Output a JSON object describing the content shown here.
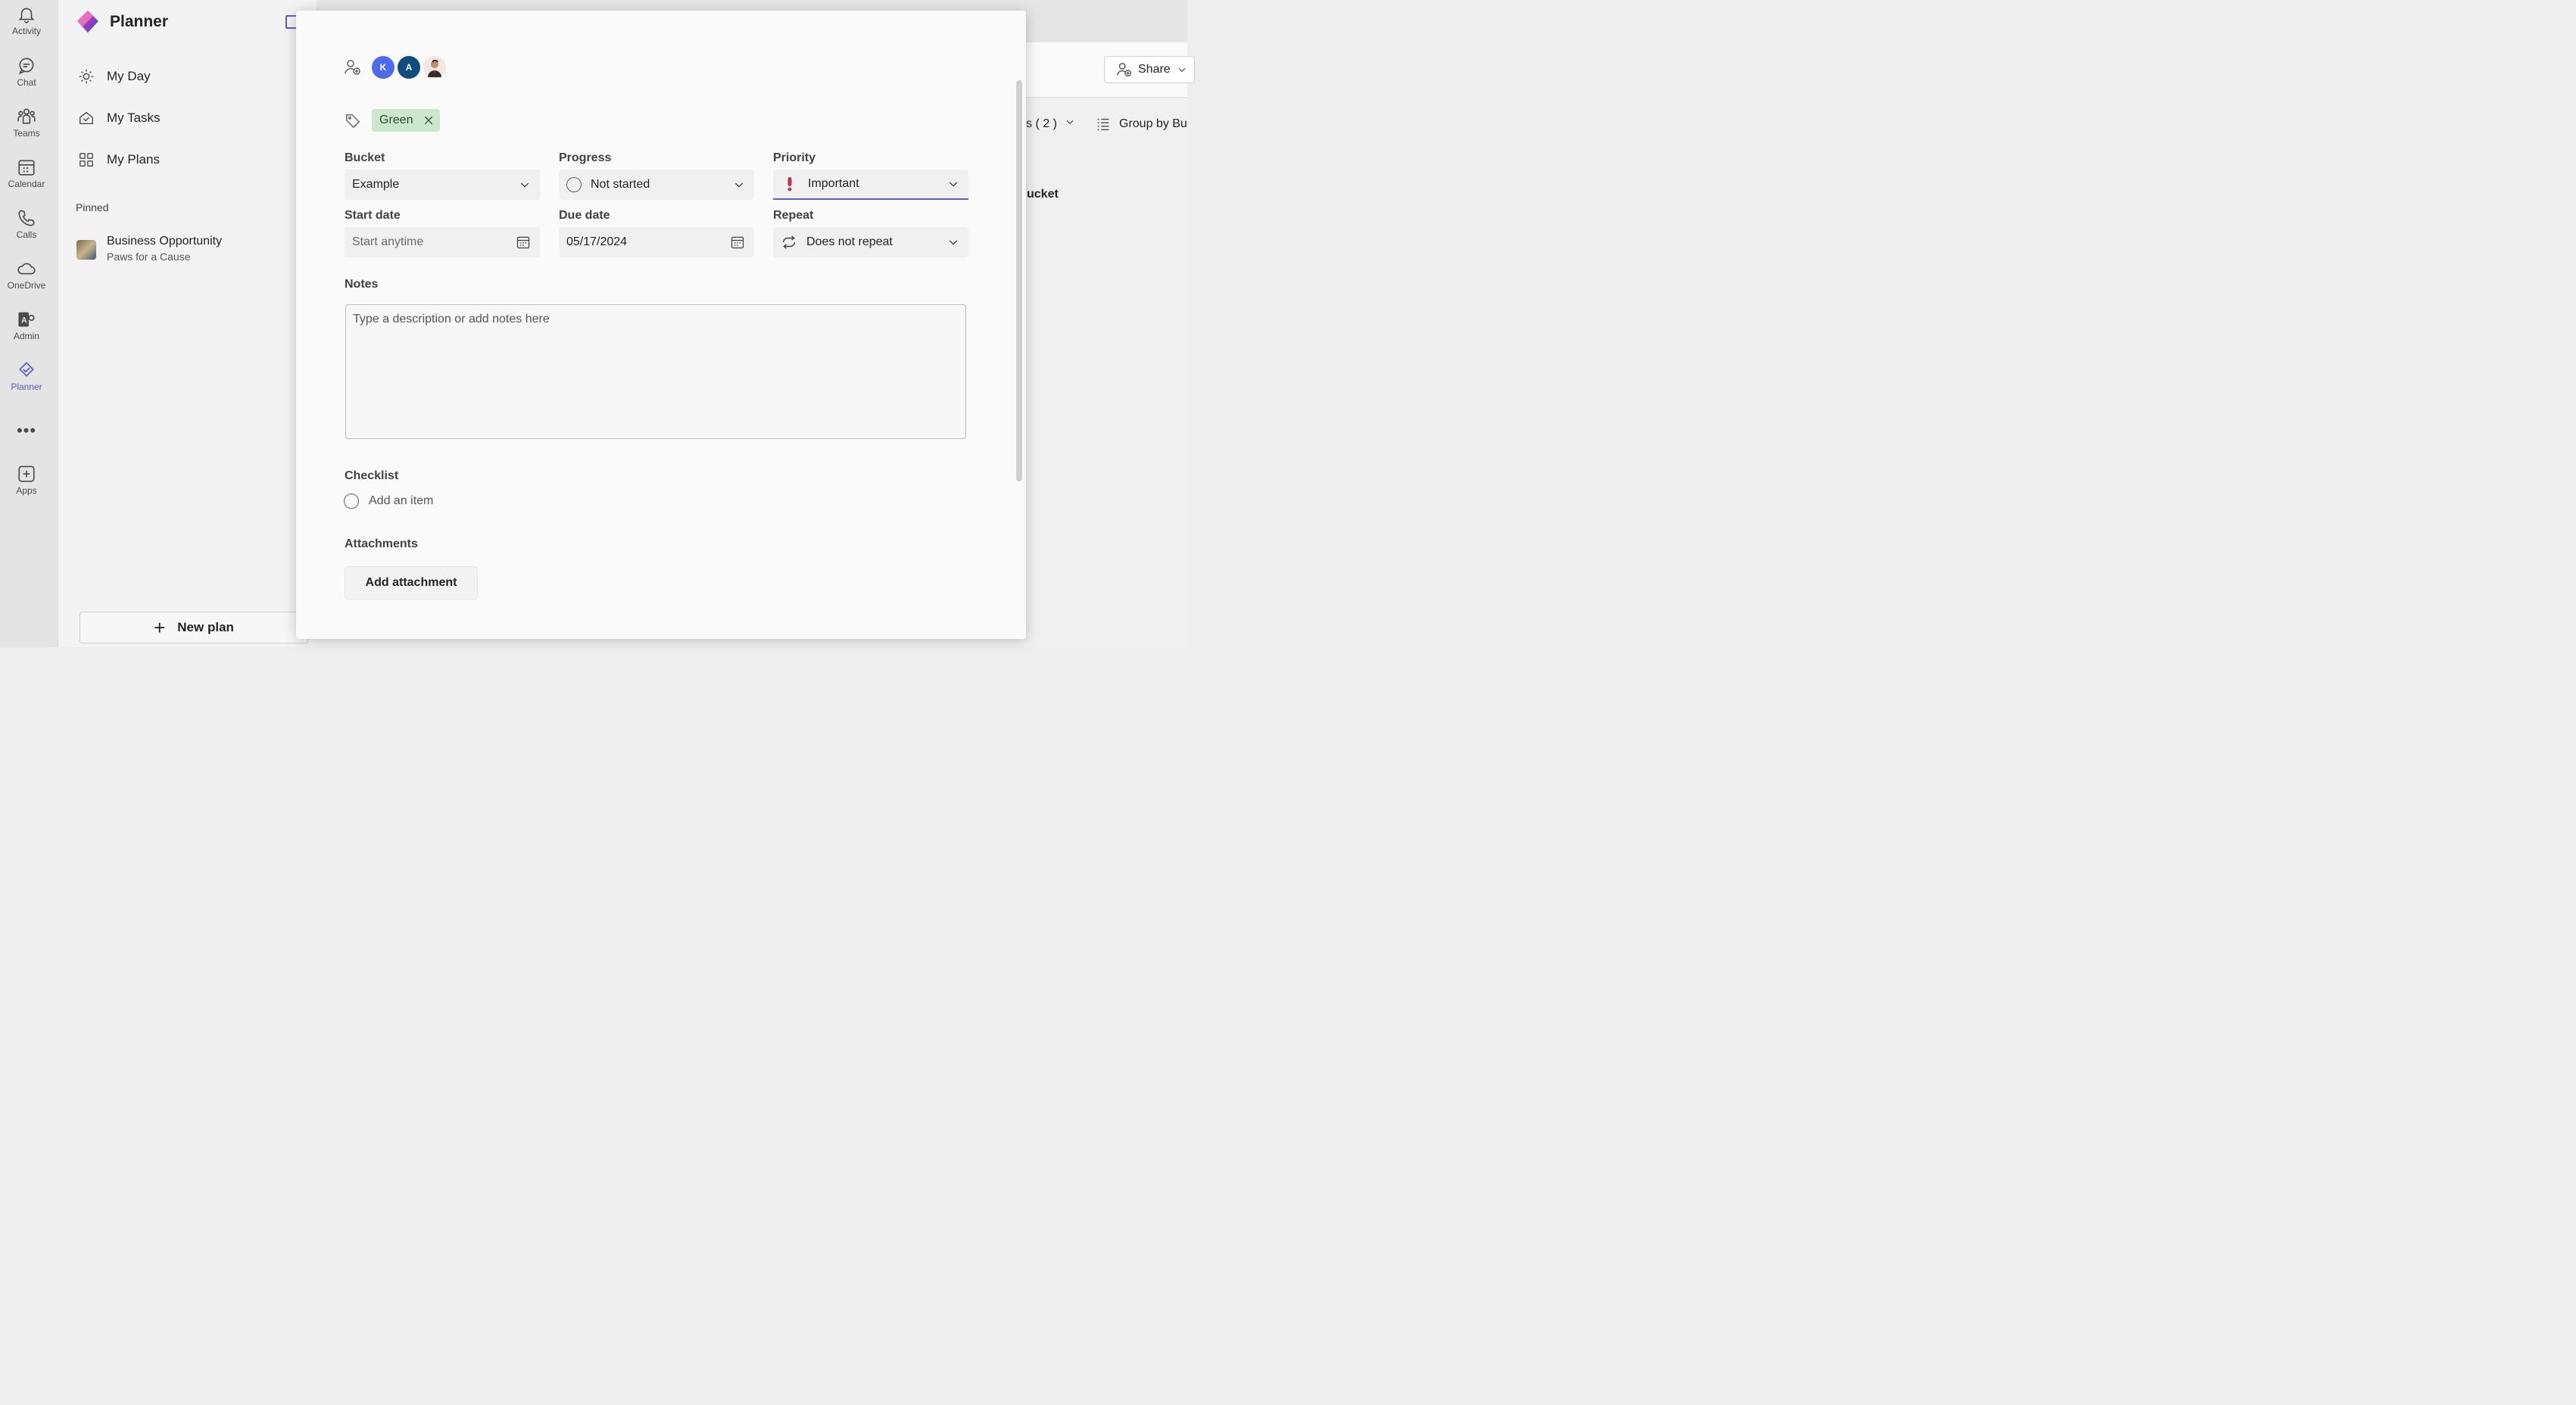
{
  "rail": {
    "items": [
      {
        "label": "Activity",
        "icon": "bell-icon"
      },
      {
        "label": "Chat",
        "icon": "chat-icon"
      },
      {
        "label": "Teams",
        "icon": "teams-icon"
      },
      {
        "label": "Calendar",
        "icon": "calendar-icon"
      },
      {
        "label": "Calls",
        "icon": "phone-icon"
      },
      {
        "label": "OneDrive",
        "icon": "cloud-icon"
      },
      {
        "label": "Admin",
        "icon": "admin-icon"
      },
      {
        "label": "Planner",
        "icon": "planner-icon",
        "active": true
      },
      {
        "label": "Apps",
        "icon": "add-app-icon"
      }
    ],
    "more": "•••",
    "active_color": "#5b5fc7"
  },
  "sidebar": {
    "app_title": "Planner",
    "nav": [
      {
        "label": "My Day",
        "icon": "sun-icon"
      },
      {
        "label": "My Tasks",
        "icon": "home-check-icon"
      },
      {
        "label": "My Plans",
        "icon": "grid-icon"
      }
    ],
    "pinned_label": "Pinned",
    "pinned_plan": {
      "title": "Business Opportunity",
      "subtitle": "Paws for a Cause"
    },
    "new_plan": "New plan"
  },
  "board": {
    "share": "Share",
    "filter_text": "s ( 2 )",
    "group_by": "Group by Bu",
    "bucket_label": "ucket"
  },
  "task": {
    "assignees": [
      {
        "initial": "K",
        "color": "#4f6bed"
      },
      {
        "initial": "A",
        "color": "#0f4c81"
      },
      {
        "initial": "",
        "color": "#8a6e5c",
        "photo": true
      }
    ],
    "label_chip": "Green",
    "bucket": {
      "label": "Bucket",
      "value": "Example"
    },
    "progress": {
      "label": "Progress",
      "value": "Not started"
    },
    "priority": {
      "label": "Priority",
      "value": "Important",
      "color": "#c4314b"
    },
    "start_date": {
      "label": "Start date",
      "placeholder": "Start anytime"
    },
    "due_date": {
      "label": "Due date",
      "value": "05/17/2024"
    },
    "repeat": {
      "label": "Repeat",
      "value": "Does not repeat"
    },
    "notes": {
      "label": "Notes",
      "placeholder": "Type a description or add notes here"
    },
    "checklist": {
      "label": "Checklist",
      "add": "Add an item"
    },
    "attachments": {
      "label": "Attachments",
      "button": "Add attachment"
    }
  }
}
